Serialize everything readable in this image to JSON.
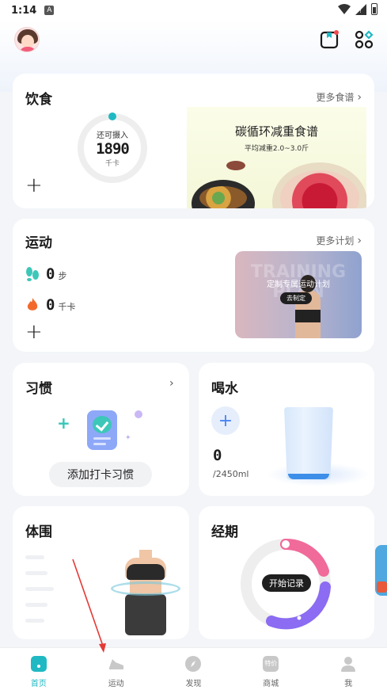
{
  "status_bar": {
    "time": "1:14",
    "notif_letter": "A"
  },
  "diet": {
    "title": "饮食",
    "more": "更多食谱",
    "remaining_label": "还可摄入",
    "remaining_value": "1890",
    "unit": "千卡",
    "add": "+",
    "banner_title": "碳循环减重食谱",
    "banner_sub": "平均减重2.0~3.0斤"
  },
  "exercise": {
    "title": "运动",
    "more": "更多计划",
    "steps_value": "0",
    "steps_unit": "步",
    "kcal_value": "0",
    "kcal_unit": "千卡",
    "add": "+",
    "plan_bg_text": "TRAINING PLAN",
    "plan_title": "定制专属运动计划",
    "plan_button": "去制定"
  },
  "habit": {
    "title": "习惯",
    "button": "添加打卡习惯"
  },
  "water": {
    "title": "喝水",
    "value": "0",
    "target": "/2450ml",
    "add": "+"
  },
  "body_measure": {
    "title": "体围"
  },
  "period": {
    "title": "经期",
    "button": "开始记录"
  },
  "bottom_nav": [
    {
      "label": "首页",
      "icon": "home-icon",
      "active": true
    },
    {
      "label": "运动",
      "icon": "shoe-icon",
      "active": false
    },
    {
      "label": "发现",
      "icon": "compass-icon",
      "active": false
    },
    {
      "label": "商城",
      "icon": "shop-icon",
      "active": false,
      "badge": "特价"
    },
    {
      "label": "我",
      "icon": "profile-icon",
      "active": false
    }
  ],
  "colors": {
    "accent": "#20b9c3",
    "period_pink": "#f06a9a",
    "period_purple": "#8b6cf2",
    "water_blue": "#3d8ee8"
  }
}
